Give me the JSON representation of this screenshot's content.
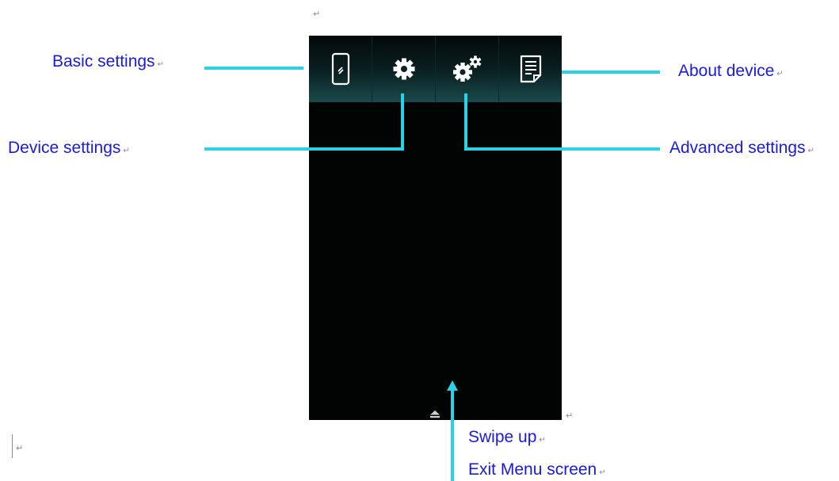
{
  "paragraph_mark": "↵",
  "device": {
    "icons": [
      {
        "name": "phone-icon",
        "label": "Basic settings"
      },
      {
        "name": "gear-icon",
        "label": "Device settings"
      },
      {
        "name": "gears-icon",
        "label": "Advanced settings"
      },
      {
        "name": "document-icon",
        "label": "About device"
      }
    ],
    "swipe_handle_icon": "eject-up-icon"
  },
  "callouts": {
    "basic_settings": "Basic settings",
    "device_settings": "Device settings",
    "about_device": "About device",
    "advanced_settings": "Advanced settings",
    "swipe_up": "Swipe up",
    "exit_menu": "Exit Menu screen"
  },
  "colors": {
    "callout_text": "#1a1adf",
    "leader_line": "#29d3e6",
    "screen_background": "#020303",
    "icon_bar_gradient_bottom": "#1a4a4c"
  }
}
